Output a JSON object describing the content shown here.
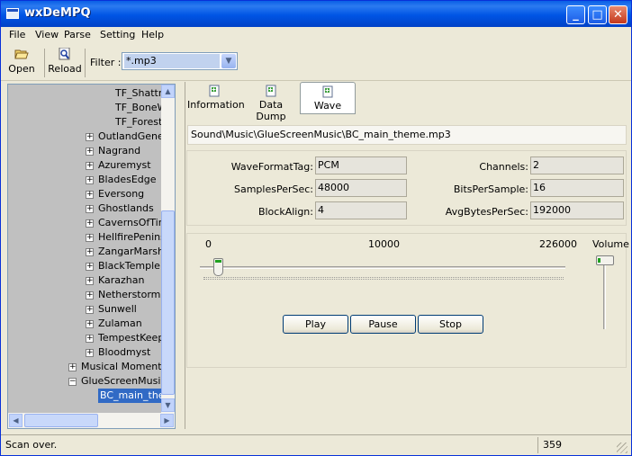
{
  "window": {
    "title": "wxDeMPQ"
  },
  "menu": [
    "File",
    "View",
    "Parse",
    "Setting",
    "Help"
  ],
  "toolbar": {
    "open_label": "Open",
    "reload_label": "Reload",
    "filter_label": "Filter :",
    "filter_value": "*.mp3"
  },
  "tree": {
    "items": [
      "TF_Shattr",
      "TF_BoneW",
      "TF_Forest",
      "OutlandGenera",
      "Nagrand",
      "Azuremyst",
      "BladesEdge",
      "Eversong",
      "Ghostlands",
      "CavernsOfTim",
      "HellfirePeninsu",
      "ZangarMarsh",
      "BlackTemple",
      "Karazhan",
      "Netherstorm",
      "Sunwell",
      "Zulaman",
      "TempestKeep",
      "Bloodmyst",
      "Musical Moments",
      "GlueScreenMusic",
      "BC_main_them"
    ]
  },
  "tabs": {
    "information": "Information",
    "data_dump": "Data Dump",
    "wave": "Wave"
  },
  "file_path": "Sound\\Music\\GlueScreenMusic\\BC_main_theme.mp3",
  "props": {
    "wave_format_label": "WaveFormatTag:",
    "wave_format_value": "PCM",
    "samples_label": "SamplesPerSec:",
    "samples_value": "48000",
    "block_align_label": "BlockAlign:",
    "block_align_value": "4",
    "channels_label": "Channels:",
    "channels_value": "2",
    "bits_label": "BitsPerSample:",
    "bits_value": "16",
    "avg_bytes_label": "AvgBytesPerSec:",
    "avg_bytes_value": "192000"
  },
  "player": {
    "min": "0",
    "current": "10000",
    "max": "226000",
    "volume_label": "Volume",
    "play": "Play",
    "pause": "Pause",
    "stop": "Stop"
  },
  "status": {
    "text": "Scan over.",
    "count": "359"
  }
}
